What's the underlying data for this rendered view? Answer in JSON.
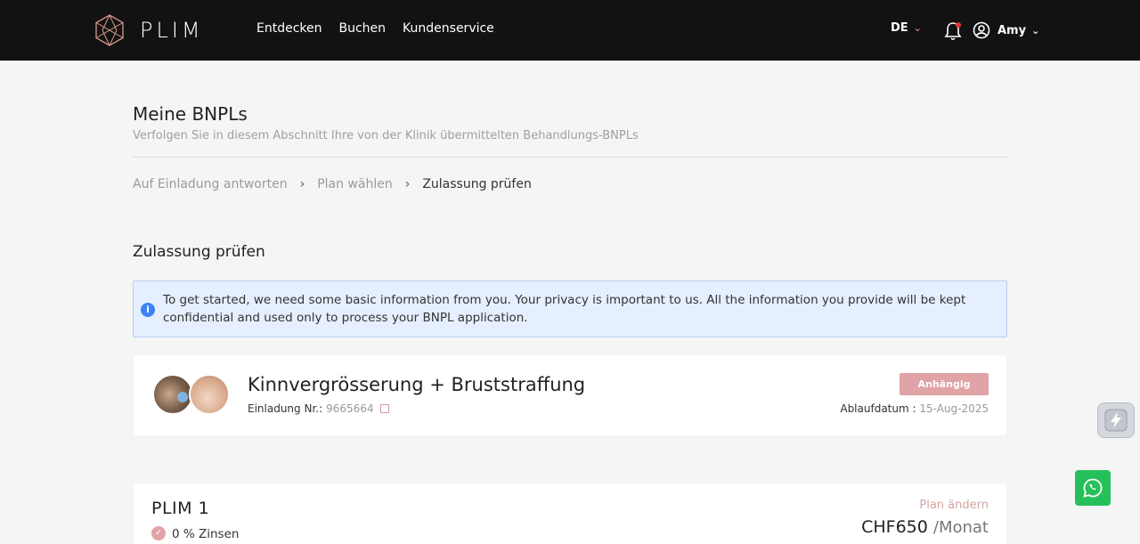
{
  "header": {
    "brand": "PLIM",
    "nav": [
      "Entdecken",
      "Buchen",
      "Kundenservice"
    ],
    "language": "DE",
    "user_name": "Amy"
  },
  "page": {
    "title": "Meine BNPLs",
    "subtitle": "Verfolgen Sie in diesem Abschnitt Ihre von der Klinik übermittelten Behandlungs-BNPLs"
  },
  "breadcrumb": {
    "steps": [
      "Auf Einladung antworten",
      "Plan wählen",
      "Zulassung prüfen"
    ]
  },
  "section": {
    "title": "Zulassung prüfen",
    "info_icon": "i",
    "info_message": "To get started, we need some basic information from you. Your privacy is important to us. All the information you provide will be kept confidential and used only to process your BNPL application."
  },
  "treatment_card": {
    "title": "Kinnvergrösserung + Bruststraffung",
    "invite_label": "Einladung Nr.:",
    "invite_number": "9665664",
    "status": "Anhängig",
    "expiry_label": "Ablaufdatum :",
    "expiry_date": "15-Aug-2025"
  },
  "plan": {
    "name": "PLIM 1",
    "feature": "0 % Zinsen",
    "change_label": "Plan ändern",
    "price": "CHF650",
    "period": "/Monat"
  },
  "colors": {
    "header_bg": "#121212",
    "accent": "#e0a3a6",
    "info_bg": "#e6efff",
    "whatsapp": "#25c05a"
  }
}
